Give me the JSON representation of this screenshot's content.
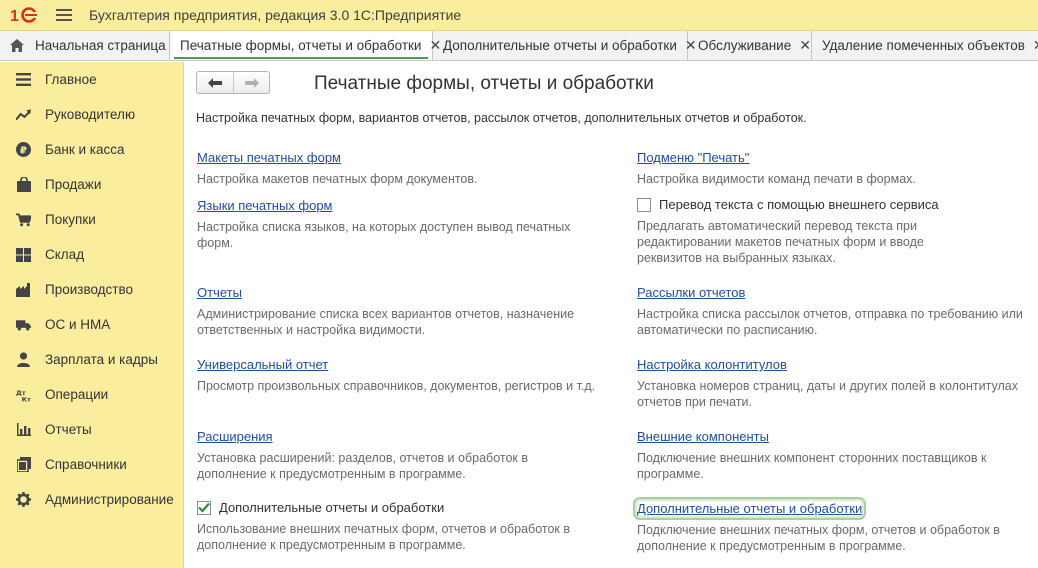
{
  "window": {
    "title": "Бухгалтерия предприятия, редакция 3.0 1С:Предприятие"
  },
  "tabs": [
    {
      "label": "Начальная страница",
      "closable": false
    },
    {
      "label": "Печатные формы, отчеты и обработки",
      "closable": true,
      "active": true
    },
    {
      "label": "Дополнительные отчеты и обработки",
      "closable": true
    },
    {
      "label": "Обслуживание",
      "closable": true
    },
    {
      "label": "Удаление помеченных объектов",
      "closable": true
    }
  ],
  "tab_close_glyph": "✕",
  "sidebar": {
    "items": [
      {
        "label": "Главное",
        "icon": "list-icon"
      },
      {
        "label": "Руководителю",
        "icon": "trend-icon"
      },
      {
        "label": "Банк и касса",
        "icon": "ruble-icon"
      },
      {
        "label": "Продажи",
        "icon": "bag-icon"
      },
      {
        "label": "Покупки",
        "icon": "cart-icon"
      },
      {
        "label": "Склад",
        "icon": "warehouse-icon"
      },
      {
        "label": "Производство",
        "icon": "factory-icon"
      },
      {
        "label": "ОС и НМА",
        "icon": "truck-icon"
      },
      {
        "label": "Зарплата и кадры",
        "icon": "person-icon"
      },
      {
        "label": "Операции",
        "icon": "dt-kt-icon"
      },
      {
        "label": "Отчеты",
        "icon": "bar-chart-icon"
      },
      {
        "label": "Справочники",
        "icon": "books-icon"
      },
      {
        "label": "Администрирование",
        "icon": "gear-icon"
      }
    ]
  },
  "main": {
    "title": "Печатные формы, отчеты и обработки",
    "intro": "Настройка печатных форм, вариантов отчетов, рассылок отчетов, дополнительных отчетов и обработок.",
    "left": [
      {
        "type": "link",
        "label": "Макеты печатных форм",
        "desc": "Настройка макетов печатных форм документов."
      },
      {
        "type": "link",
        "label": "Языки печатных форм",
        "desc": "Настройка списка языков, на которых доступен вывод печатных форм."
      },
      {
        "type": "link",
        "label": "Отчеты",
        "desc": "Администрирование списка всех вариантов отчетов, назначение ответственных и настройка видимости."
      },
      {
        "type": "link",
        "label": "Универсальный отчет",
        "desc": "Просмотр произвольных справочников, документов, регистров и т.д."
      },
      {
        "type": "link",
        "label": "Расширения",
        "desc": "Установка расширений: разделов, отчетов и обработок в дополнение к предусмотренным в программе."
      },
      {
        "type": "checkbox",
        "label": "Дополнительные отчеты и обработки",
        "checked": true,
        "desc": "Использование внешних печатных форм, отчетов и обработок в дополнение к предусмотренным в программе."
      }
    ],
    "right": [
      {
        "type": "link",
        "label": "Подменю \"Печать\"",
        "desc": "Настройка видимости команд печати в формах."
      },
      {
        "type": "checkbox",
        "label": "Перевод текста с помощью внешнего сервиса",
        "checked": false,
        "desc": "Предлагать автоматический перевод текста при редактировании макетов печатных форм и вводе реквизитов на выбранных языках."
      },
      {
        "type": "link",
        "label": "Рассылки отчетов",
        "desc": "Настройка списка рассылок отчетов, отправка по требованию или автоматически по расписанию."
      },
      {
        "type": "link",
        "label": "Настройка колонтитулов",
        "desc": "Установка номеров страниц, даты и других полей в колонтитулах отчетов при печати."
      },
      {
        "type": "link",
        "label": "Внешние компоненты",
        "desc": "Подключение внешних компонент сторонних поставщиков к программе."
      },
      {
        "type": "link",
        "label": "Дополнительные отчеты и обработки",
        "focused": true,
        "desc": "Подключение внешних печатных форм, отчетов и обработок в дополнение к предусмотренным в программе."
      }
    ]
  }
}
